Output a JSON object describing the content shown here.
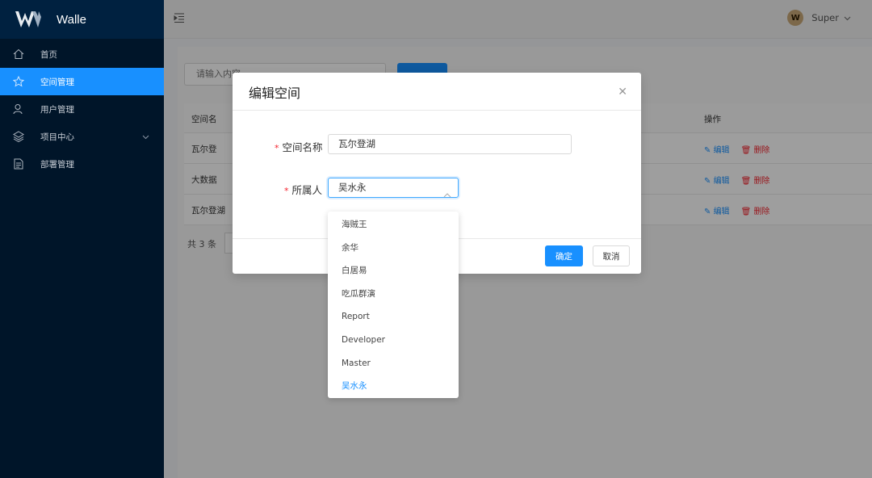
{
  "app": {
    "name": "Walle"
  },
  "sidebar": {
    "items": [
      {
        "label": "首页",
        "icon": "home-icon"
      },
      {
        "label": "空间管理",
        "icon": "star-icon",
        "active": true
      },
      {
        "label": "用户管理",
        "icon": "user-icon"
      },
      {
        "label": "项目中心",
        "icon": "layers-icon",
        "has_arrow": true
      },
      {
        "label": "部署管理",
        "icon": "document-icon"
      }
    ]
  },
  "header": {
    "user": "Super",
    "avatar_letter": "W"
  },
  "page": {
    "search_placeholder": "请输入内容",
    "table": {
      "headers": {
        "name": "空间名",
        "ops": "操作"
      },
      "rows": [
        {
          "name": "瓦尔登",
          "edit": "编辑",
          "delete": "删除"
        },
        {
          "name": "大数据",
          "edit": "编辑",
          "delete": "删除"
        },
        {
          "name": "瓦尔登湖",
          "edit": "编辑",
          "delete": "删除"
        }
      ]
    },
    "total_text": "共 3 条"
  },
  "modal": {
    "title": "编辑空间",
    "fields": {
      "name_label": "空间名称",
      "name_value": "瓦尔登湖",
      "owner_label": "所属人",
      "owner_value": "吴水永"
    },
    "ok_label": "确定",
    "cancel_label": "取消"
  },
  "dropdown": {
    "options": [
      "海贼王",
      "余华",
      "白居易",
      "吃瓜群演",
      "Report",
      "Developer",
      "Master",
      "吴水永"
    ],
    "selected": "吴水永"
  },
  "colors": {
    "sidebar_bg": "#001529",
    "accent": "#1890ff",
    "danger": "#f5222d"
  }
}
